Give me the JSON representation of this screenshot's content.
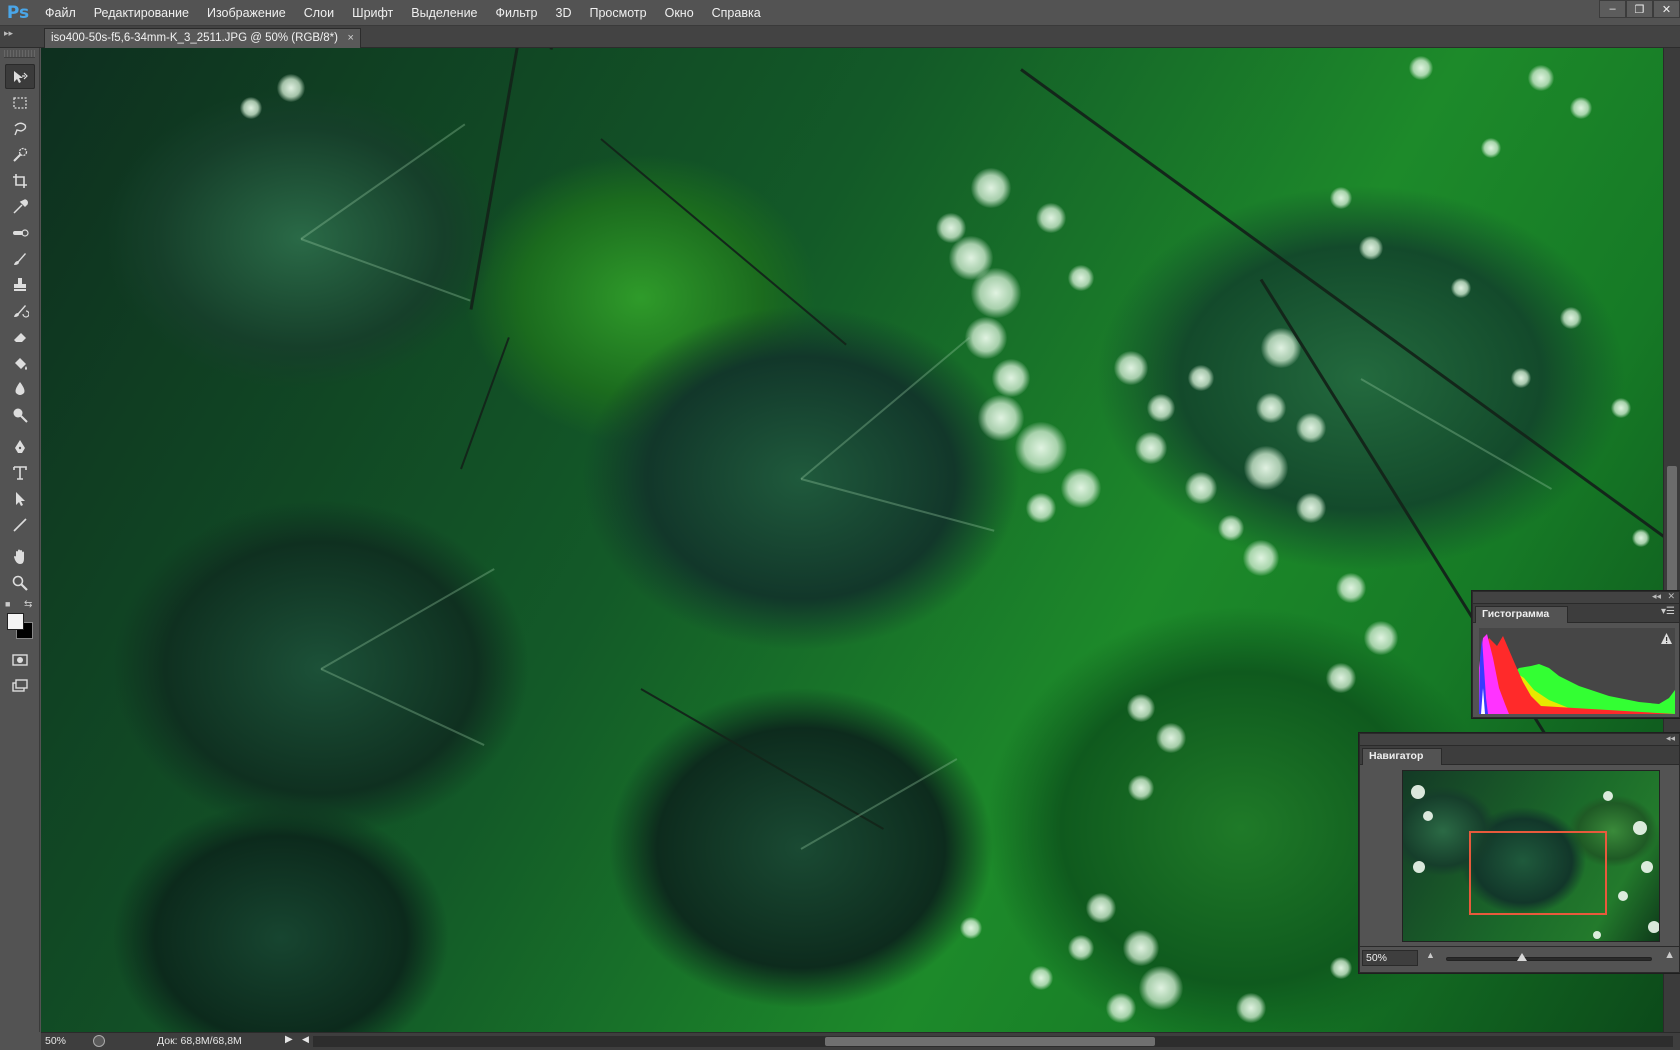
{
  "app": {
    "logo": "Ps",
    "menu": [
      "Файл",
      "Редактирование",
      "Изображение",
      "Слои",
      "Шрифт",
      "Выделение",
      "Фильтр",
      "3D",
      "Просмотр",
      "Окно",
      "Справка"
    ],
    "window_controls": [
      "–",
      "❐",
      "✕"
    ]
  },
  "document": {
    "tab_title": "iso400-50s-f5,6-34mm-K_3_2511.JPG @ 50% (RGB/8*)",
    "tab_close": "×"
  },
  "tools": [
    "move-tool",
    "marquee-tool",
    "lasso-tool",
    "quick-selection-tool",
    "crop-tool",
    "eyedropper-tool",
    "spot-healing-tool",
    "brush-tool",
    "clone-stamp-tool",
    "history-brush-tool",
    "eraser-tool",
    "paint-bucket-tool",
    "blur-tool",
    "dodge-tool",
    "pen-tool",
    "type-tool",
    "path-selection-tool",
    "line-tool",
    "hand-tool",
    "zoom-tool"
  ],
  "colors": {
    "foreground": "#f4f4f4",
    "background": "#000000",
    "navigator_view_box": "#e85a3c"
  },
  "status": {
    "zoom": "50%",
    "doc_size": "Док: 68,8M/68,8M",
    "arrow": "▶",
    "left_arrow": "◀"
  },
  "histogram_panel": {
    "tab_label": "Гистограмма",
    "warning_icon": "warning-icon"
  },
  "navigator_panel": {
    "tab_label": "Навигатор",
    "zoom_value": "50%",
    "zoom_slider_position": 0.37
  }
}
